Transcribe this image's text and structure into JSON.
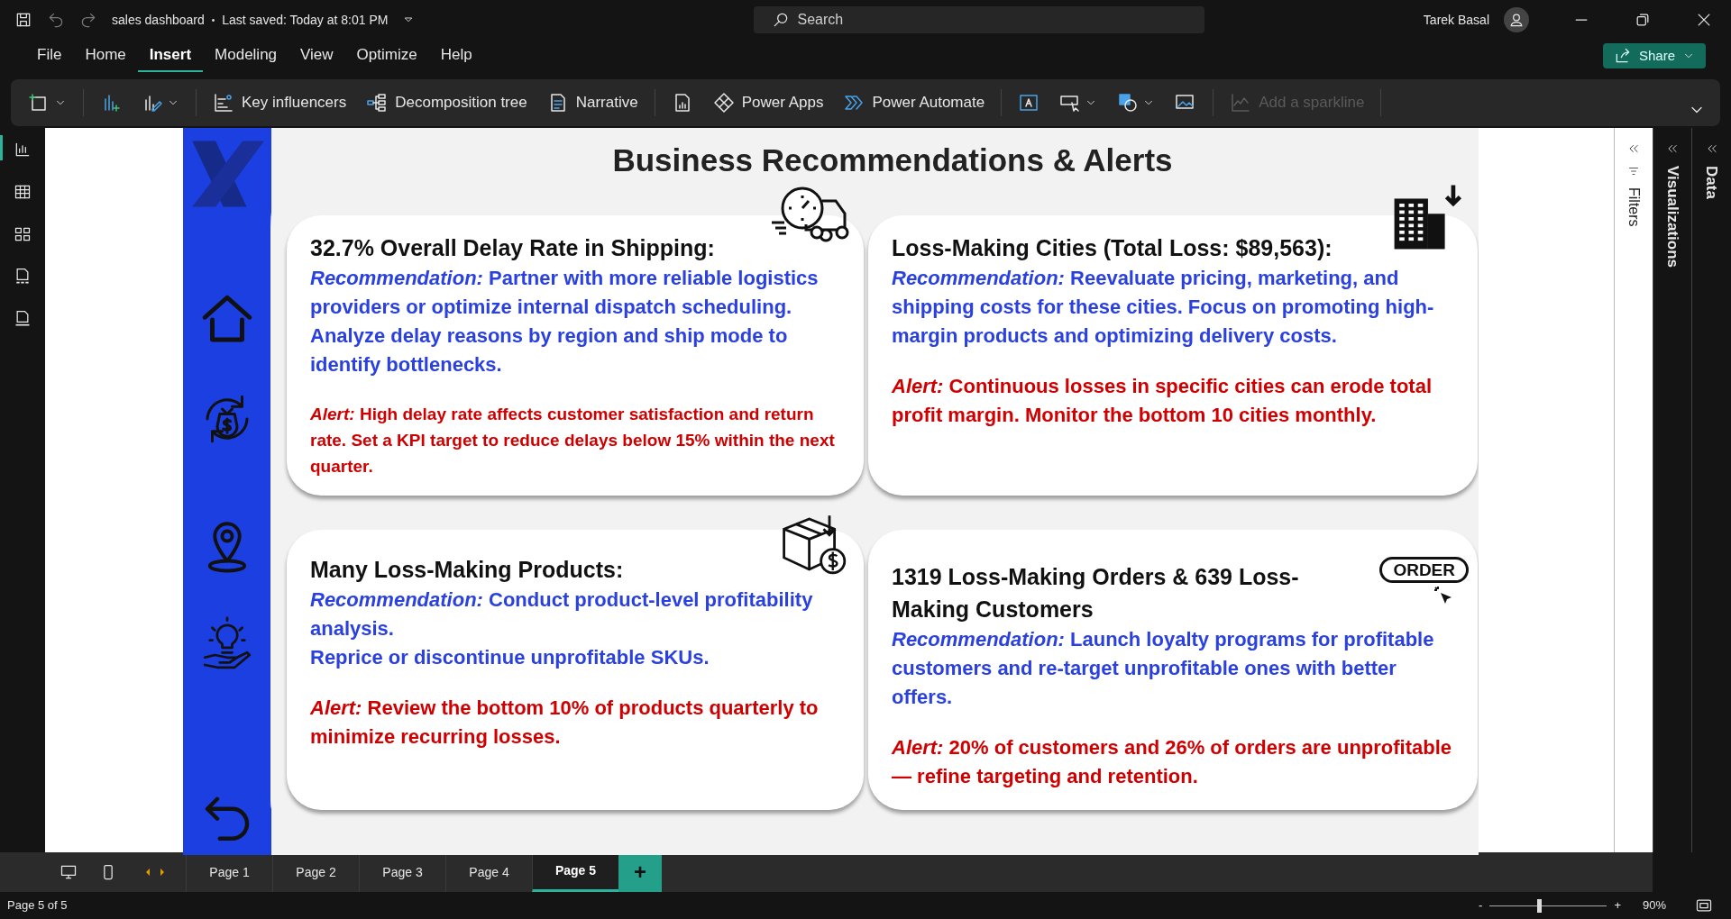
{
  "title_bar": {
    "file_name": "sales dashboard",
    "separator": "•",
    "saved": "Last saved: Today at 8:01 PM",
    "search_placeholder": "Search",
    "user": "Tarek Basal"
  },
  "menu": [
    {
      "label": "File",
      "selected": false
    },
    {
      "label": "Home",
      "selected": false
    },
    {
      "label": "Insert",
      "selected": true
    },
    {
      "label": "Modeling",
      "selected": false
    },
    {
      "label": "View",
      "selected": false
    },
    {
      "label": "Optimize",
      "selected": false
    },
    {
      "label": "Help",
      "selected": false
    }
  ],
  "share_button": "Share",
  "ribbon": [
    {
      "kind": "icon",
      "disabled": false
    },
    {
      "kind": "icon",
      "disabled": false
    },
    {
      "kind": "icon",
      "disabled": false
    },
    {
      "kind": "label",
      "label": "Key influencers",
      "disabled": false
    },
    {
      "kind": "label",
      "label": "Decomposition tree",
      "disabled": false
    },
    {
      "kind": "label",
      "label": "Narrative",
      "disabled": false
    },
    {
      "kind": "icon",
      "disabled": false
    },
    {
      "kind": "label",
      "label": "Power Apps",
      "disabled": false
    },
    {
      "kind": "label",
      "label": "Power Automate",
      "disabled": false
    },
    {
      "kind": "icon",
      "disabled": false
    },
    {
      "kind": "icon",
      "disabled": false
    },
    {
      "kind": "icon",
      "disabled": false
    },
    {
      "kind": "icon",
      "disabled": false
    },
    {
      "kind": "label",
      "label": "Add a sparkline",
      "disabled": true
    }
  ],
  "report": {
    "title": "Business Recommendations & Alerts",
    "cards": [
      {
        "title": "32.7% Overall Delay Rate in Shipping:",
        "recommendation": [
          "*Recommendation:* Partner with more reliable logistics providers or optimize internal dispatch scheduling. Analyze delay reasons by region and  ship mode to identify bottlenecks."
        ],
        "alert": "*Alert:* High delay rate affects customer satisfaction and return rate. Set a KPI target to reduce delays below  15% within the next quarter."
      },
      {
        "title": "Loss-Making Cities (Total Loss: $89,563):",
        "recommendation": [
          "*Recommendation:* Reevaluate pricing, marketing, and shipping costs for these cities. Focus on promoting high-margin products and optimizing delivery costs."
        ],
        "alert": "*Alert:* Continuous losses in specific cities can erode total profit margin. Monitor the bottom 10 cities monthly."
      },
      {
        "title": "Many Loss-Making Products:",
        "recommendation": [
          "*Recommendation:* Conduct product-level profitability analysis.",
          "Reprice or discontinue unprofitable SKUs."
        ],
        "alert": "*Alert:* Review the bottom 10% of products quarterly to minimize recurring losses."
      },
      {
        "badge": "ORDER",
        "title": "1319 Loss-Making Orders & 639 Loss-Making Customers",
        "recommendation": [
          "*Recommendation:* Launch loyalty programs for profitable customers and re-target unprofitable ones with better offers."
        ],
        "alert": "*Alert:* 20% of customers and 26% of orders are unprofitable — refine targeting and retention."
      }
    ]
  },
  "side_panels": [
    {
      "label": "Filters"
    },
    {
      "label": "Visualizations"
    },
    {
      "label": "Data"
    }
  ],
  "pages": [
    {
      "label": "Page 1",
      "selected": false
    },
    {
      "label": "Page 2",
      "selected": false
    },
    {
      "label": "Page 3",
      "selected": false
    },
    {
      "label": "Page 4",
      "selected": false
    },
    {
      "label": "Page 5",
      "selected": true
    }
  ],
  "add_page": "+",
  "status_bar": {
    "page_info": "Page 5 of 5",
    "zoom_out": "-",
    "zoom_in": "+",
    "zoom": "90%",
    "zoom_slider": {
      "level": 0.42
    }
  }
}
